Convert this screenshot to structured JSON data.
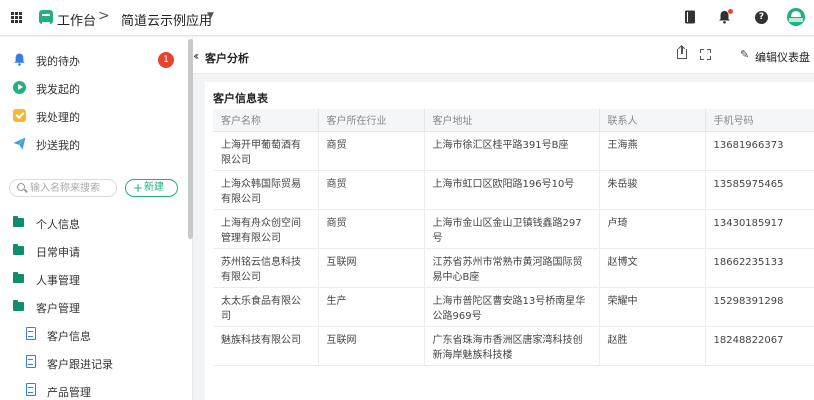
{
  "header": {
    "workspace_label": "工作台",
    "breadcrumb_separator": ">",
    "app_name": "简道云示例应用"
  },
  "sidebar": {
    "quick_items": [
      {
        "label": "我的待办",
        "icon": "bell-icon",
        "badge": "1"
      },
      {
        "label": "我发起的",
        "icon": "play-icon"
      },
      {
        "label": "我处理的",
        "icon": "task-icon"
      },
      {
        "label": "抄送我的",
        "icon": "send-icon"
      }
    ],
    "search_placeholder": "输入名称来搜索",
    "new_button": "新建",
    "groups": [
      {
        "label": "个人信息"
      },
      {
        "label": "日常申请"
      },
      {
        "label": "人事管理"
      },
      {
        "label": "客户管理"
      }
    ],
    "sub_items": [
      {
        "label": "客户信息"
      },
      {
        "label": "客户跟进记录"
      },
      {
        "label": "产品管理"
      }
    ]
  },
  "main": {
    "page_title": "客户分析",
    "edit_button": "编辑仪表盘",
    "table_title": "客户信息表",
    "columns": [
      "客户名称",
      "客户所在行业",
      "客户地址",
      "联系人",
      "手机号码"
    ],
    "rows": [
      [
        "上海开甲葡萄酒有限公司",
        "商贸",
        "上海市徐汇区桂平路391号B座",
        "王海燕",
        "13681966373"
      ],
      [
        "上海众韩国际贸易有限公司",
        "商贸",
        "上海市虹口区欧阳路196号10号",
        "朱岳骏",
        "13585975465"
      ],
      [
        "上海有舟众创空间管理有限公司",
        "商贸",
        "上海市金山区金山卫镇钱鑫路297号",
        "卢琦",
        "13430185917"
      ],
      [
        "苏州铭云信息科技有限公司",
        "互联网",
        "江苏省苏州市常熟市黄河路国际贸易中心B座",
        "赵博文",
        "18662235133"
      ],
      [
        "太太乐食品有限公司",
        "生产",
        "上海市普陀区曹安路13号桥南星华公路969号",
        "荣耀中",
        "15298391298"
      ],
      [
        "魅族科技有限公司",
        "互联网",
        "广东省珠海市香洲区唐家湾科技创新海岸魅族科技楼",
        "赵胜",
        "18248822067"
      ]
    ]
  },
  "colors": {
    "accent": "#22b07d",
    "badge": "#e8422f",
    "folder": "#0f8e6e",
    "doc": "#3a7de0"
  }
}
